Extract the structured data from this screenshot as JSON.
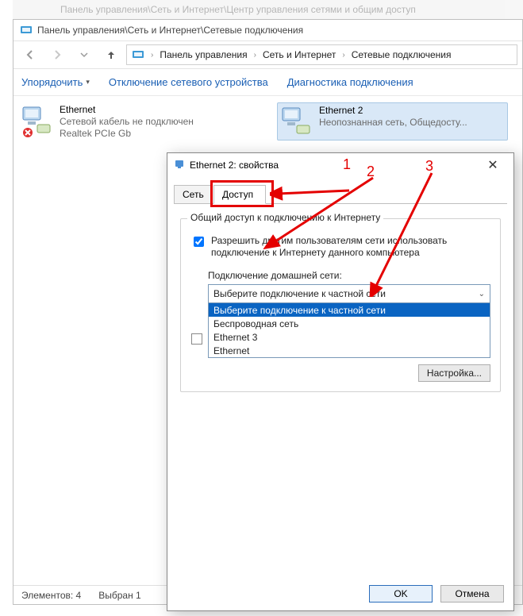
{
  "bg_fragment": "Панель управления\\Сеть и Интернет\\Центр управления сетями и общим доступ",
  "explorer": {
    "title": "Панель управления\\Сеть и Интернет\\Сетевые подключения",
    "breadcrumb": [
      "Панель управления",
      "Сеть и Интернет",
      "Сетевые подключения"
    ],
    "commands": {
      "organize": "Упорядочить",
      "disable": "Отключение сетевого устройства",
      "diagnose": "Диагностика подключения"
    },
    "connections": [
      {
        "name": "Ethernet",
        "line2": "Сетевой кабель не подключен",
        "line3": "Realtek PCIe Gb"
      },
      {
        "name": "Ethernet 2",
        "line2": "Неопознанная сеть, Общедосту...",
        "line3": ""
      }
    ],
    "status": {
      "items": "Элементов: 4",
      "selected": "Выбран 1"
    }
  },
  "dialog": {
    "title": "Ethernet 2: свойства",
    "tabs": {
      "net": "Сеть",
      "access": "Доступ"
    },
    "group_title": "Общий доступ к подключению к Интернету",
    "checkbox1": "Разрешить другим пользователям сети использовать подключение к Интернету данного компьютера",
    "select_label": "Подключение домашней сети:",
    "combo": {
      "value": "Выберите подключение к частной сети",
      "options": [
        "Выберите подключение к частной сети",
        "Беспроводная сеть",
        "Ethernet 3",
        "Ethernet"
      ]
    },
    "settings_btn": "Настройка...",
    "ok": "OK",
    "cancel": "Отмена"
  },
  "annotations": {
    "one": "1",
    "two": "2",
    "three": "3"
  }
}
